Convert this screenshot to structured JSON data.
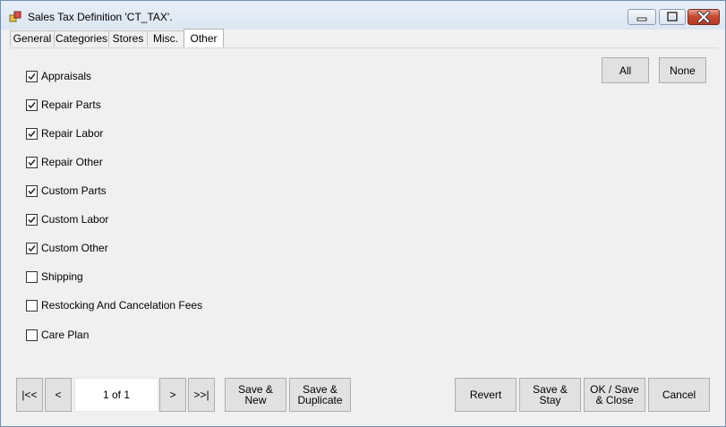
{
  "window": {
    "title": "Sales Tax Definition 'CT_TAX'.",
    "icon": "app-window-icon",
    "controls": {
      "minimize": "minimize-icon",
      "maximize": "maximize-icon",
      "close": "close-icon"
    }
  },
  "tabs": [
    {
      "label": "General",
      "active": false
    },
    {
      "label": "Categories",
      "active": false
    },
    {
      "label": "Stores",
      "active": false
    },
    {
      "label": "Misc.",
      "active": false
    },
    {
      "label": "Other",
      "active": true
    }
  ],
  "other": {
    "all_label": "All",
    "none_label": "None",
    "items": [
      {
        "label": "Appraisals",
        "checked": true
      },
      {
        "label": "Repair Parts",
        "checked": true
      },
      {
        "label": "Repair Labor",
        "checked": true
      },
      {
        "label": "Repair Other",
        "checked": true
      },
      {
        "label": "Custom Parts",
        "checked": true
      },
      {
        "label": "Custom Labor",
        "checked": true
      },
      {
        "label": "Custom Other",
        "checked": true
      },
      {
        "label": "Shipping",
        "checked": false
      },
      {
        "label": "Restocking And Cancelation Fees",
        "checked": false
      },
      {
        "label": "Care Plan",
        "checked": false
      }
    ]
  },
  "nav": {
    "first": "|<<",
    "prev": "<",
    "record": "1 of 1",
    "next": ">",
    "last": ">>|"
  },
  "actions": {
    "save_new": [
      "Save &",
      "New"
    ],
    "save_duplicate": [
      "Save &",
      "Duplicate"
    ],
    "revert": "Revert",
    "save_stay": [
      "Save &",
      "Stay"
    ],
    "ok_save_close": [
      "OK / Save",
      "& Close"
    ],
    "cancel": "Cancel"
  }
}
